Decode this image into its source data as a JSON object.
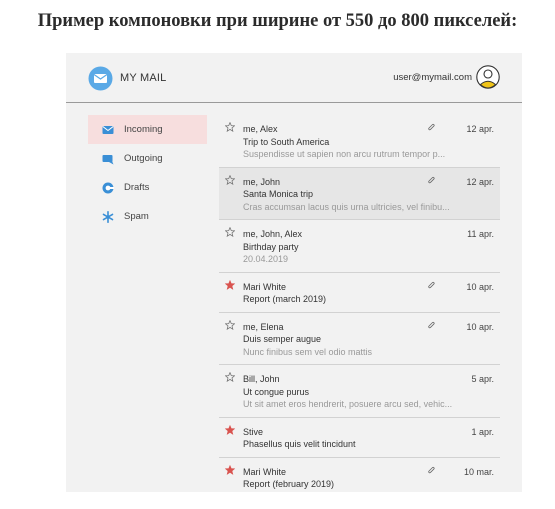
{
  "caption": "Пример компоновки при ширине от 550 до 800 пикселей:",
  "header": {
    "title": "MY MAIL",
    "user_email": "user@mymail.com"
  },
  "sidebar": {
    "items": [
      {
        "label": "Incoming",
        "icon": "inbox-icon",
        "active": true
      },
      {
        "label": "Outgoing",
        "icon": "outgoing-icon",
        "active": false
      },
      {
        "label": "Drafts",
        "icon": "drafts-icon",
        "active": false
      },
      {
        "label": "Spam",
        "icon": "spam-icon",
        "active": false
      }
    ]
  },
  "messages": [
    {
      "from": "me, Alex",
      "subject": "Trip to South America",
      "preview": "Suspendisse ut sapien non arcu rutrum tempor p...",
      "date": "12 apr.",
      "starred": false,
      "attachment": true,
      "selected": false
    },
    {
      "from": "me, John",
      "subject": "Santa Monica trip",
      "preview": "Cras accumsan lacus quis urna ultricies, vel finibu...",
      "date": "12 apr.",
      "starred": false,
      "attachment": true,
      "selected": true
    },
    {
      "from": "me, John, Alex",
      "subject": "Birthday party",
      "preview": "20.04.2019",
      "date": "11 apr.",
      "starred": false,
      "attachment": false,
      "selected": false
    },
    {
      "from": "Mari White",
      "subject": "Report (march 2019)",
      "preview": "",
      "date": "10 apr.",
      "starred": true,
      "attachment": true,
      "selected": false
    },
    {
      "from": "me, Elena",
      "subject": "Duis semper augue",
      "preview": "Nunc finibus sem vel odio mattis",
      "date": "10 apr.",
      "starred": false,
      "attachment": true,
      "selected": false
    },
    {
      "from": "Bill, John",
      "subject": "Ut congue purus",
      "preview": "Ut sit amet eros hendrerit, posuere arcu sed, vehic...",
      "date": "5 apr.",
      "starred": false,
      "attachment": false,
      "selected": false
    },
    {
      "from": "Stive",
      "subject": "Phasellus quis velit tincidunt",
      "preview": "",
      "date": "1 apr.",
      "starred": true,
      "attachment": false,
      "selected": false
    },
    {
      "from": "Mari White",
      "subject": "Report (february 2019)",
      "preview": "",
      "date": "10 mar.",
      "starred": true,
      "attachment": true,
      "selected": false
    }
  ],
  "colors": {
    "accent_active": "#f7dede",
    "star_filled": "#d9534f",
    "icon_blue": "#3a8fd6",
    "avatar_yellow": "#f0c419"
  }
}
